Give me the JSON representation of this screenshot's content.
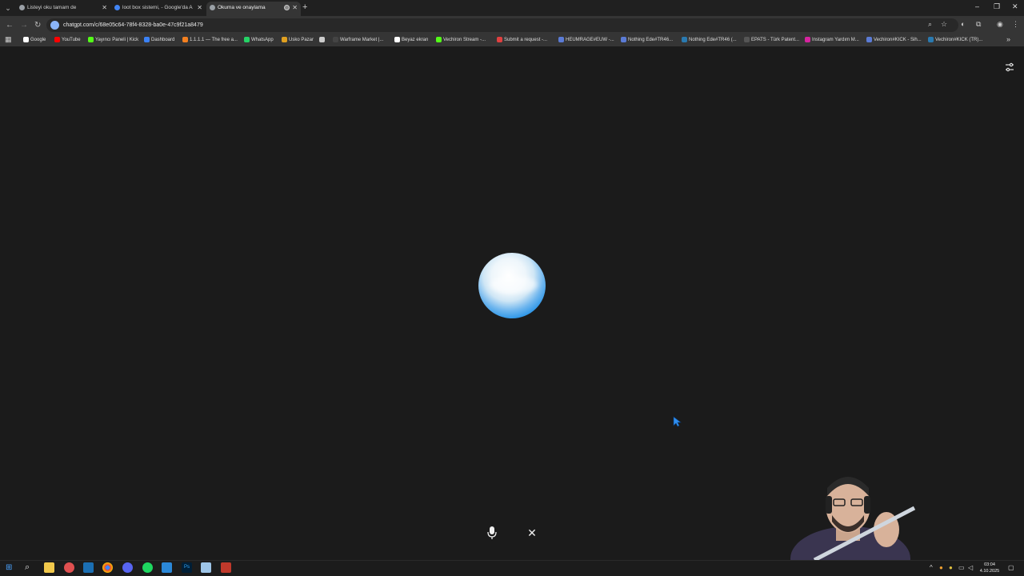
{
  "browser": {
    "tabs": [
      {
        "title": "Listeyi oku tamam de",
        "active": false
      },
      {
        "title": "loot box sistemi, - Google'da A",
        "active": false
      },
      {
        "title": "Okuma ve onaylama",
        "active": true
      }
    ],
    "url": "chatgpt.com/c/68e05c64-78f4-8328-ba0e-47c9f21a8479",
    "bookmarks": [
      {
        "label": "Google",
        "color": "#ffffff"
      },
      {
        "label": "YouTube",
        "color": "#ff0000"
      },
      {
        "label": "Yayıncı Paneli | Kick",
        "color": "#53fc18"
      },
      {
        "label": "Dashboard",
        "color": "#3b82f6"
      },
      {
        "label": "1.1.1.1 — The free a...",
        "color": "#f38020"
      },
      {
        "label": "WhatsApp",
        "color": "#25d366"
      },
      {
        "label": "Usko Pazar",
        "color": "#e0a020"
      },
      {
        "label": "",
        "color": "#cccccc"
      },
      {
        "label": "Warframe Market |...",
        "color": "#444444"
      },
      {
        "label": "Beyaz ekran",
        "color": "#ffffff"
      },
      {
        "label": "Vechiron Stream -...",
        "color": "#53fc18"
      },
      {
        "label": "Submit a request -...",
        "color": "#e04040"
      },
      {
        "label": "HEUMRAGE#EUW -...",
        "color": "#5b7bd5"
      },
      {
        "label": "Nothing Ede#TR46...",
        "color": "#5b7bd5"
      },
      {
        "label": "Nothing Ede#TR46 (...",
        "color": "#2a7ab0"
      },
      {
        "label": "EPATS - Türk Patent...",
        "color": "#555555"
      },
      {
        "label": "Instagram Yardım M...",
        "color": "#d6249f"
      },
      {
        "label": "Vechiron#KICK - Sih...",
        "color": "#5b7bd5"
      },
      {
        "label": "Vechiron#KICK (TR)...",
        "color": "#2a7ab0"
      }
    ]
  },
  "voice_mode": {
    "orb_colors": {
      "top": "#ffffff",
      "bottom": "#1a7ed8"
    },
    "mic_icon": "microphone-icon",
    "close_icon": "close-icon"
  },
  "taskbar": {
    "time": "03:04",
    "date": "4.10.2025"
  }
}
